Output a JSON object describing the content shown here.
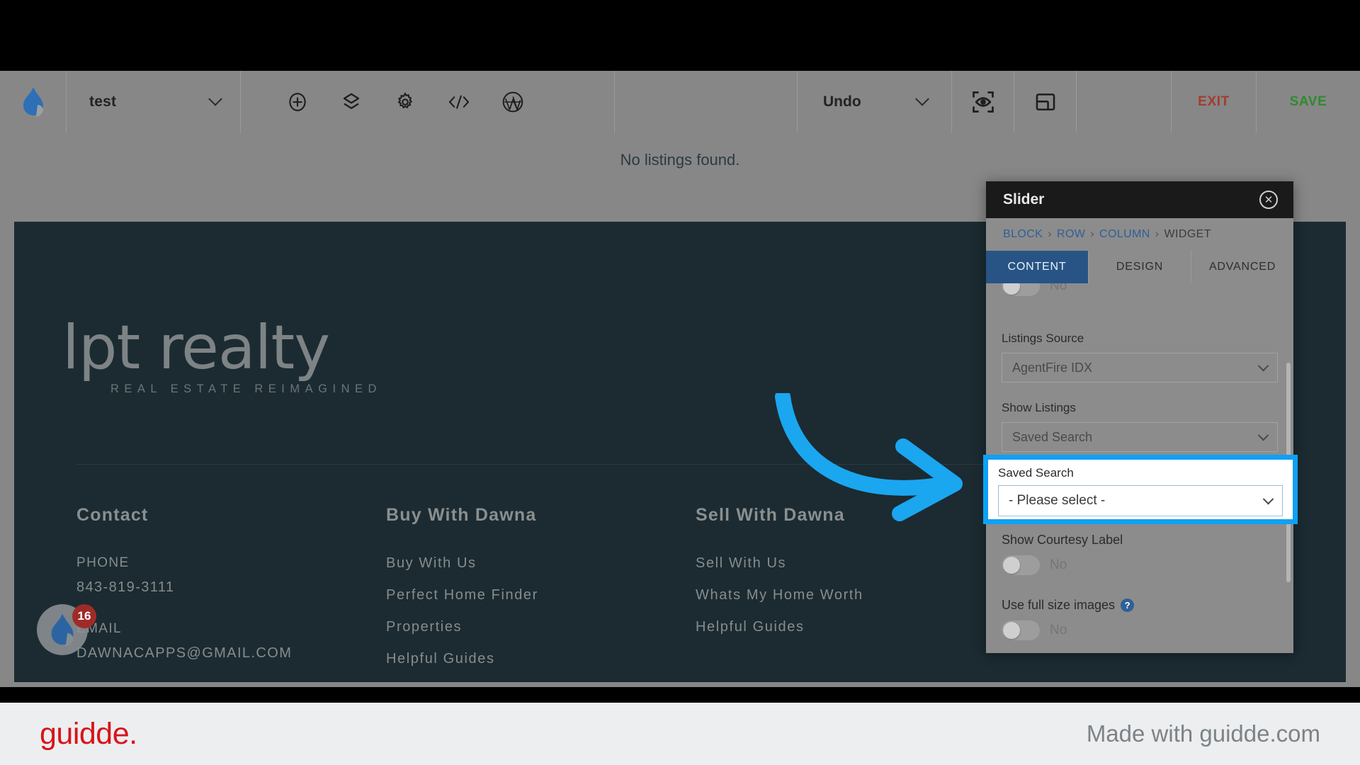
{
  "toolbar": {
    "site_title": "test",
    "icons": [
      "flame-logo-icon",
      "add-circle-icon",
      "layers-icon",
      "gear-icon",
      "code-icon",
      "wordpress-icon"
    ],
    "undo_label": "Undo",
    "preview_icon": "eye-frame-icon",
    "panel_icon": "panel-layout-icon",
    "exit_label": "EXIT",
    "save_label": "SAVE",
    "exit_color": "#a33c2e",
    "save_color": "#2f8a2f"
  },
  "canvas": {
    "no_listings": "No listings found.",
    "footer": {
      "logo_main": "lpt realty",
      "logo_sub": "REAL ESTATE REIMAGINED",
      "columns": [
        {
          "heading": "Contact",
          "sub_label_1": "PHONE",
          "sub_value_1": "843-819-3111",
          "sub_label_2": "EMAIL",
          "sub_value_2": "DAWNACAPPS@GMAIL.COM"
        },
        {
          "heading": "Buy With Dawna",
          "links": [
            "Buy With Us",
            "Perfect Home Finder",
            "Properties",
            "Helpful Guides"
          ]
        },
        {
          "heading": "Sell With Dawna",
          "links": [
            "Sell With Us",
            "Whats My Home Worth",
            "Helpful Guides"
          ]
        }
      ]
    },
    "chat_badge_count": "16"
  },
  "panel": {
    "title": "Slider",
    "close_icon": "close-icon",
    "breadcrumb": {
      "items": [
        "BLOCK",
        "ROW",
        "COLUMN",
        "WIDGET"
      ],
      "separator": "›"
    },
    "tabs": [
      {
        "label": "CONTENT",
        "active": true
      },
      {
        "label": "DESIGN",
        "active": false
      },
      {
        "label": "ADVANCED",
        "active": false
      }
    ],
    "cut_toggle_value": "No",
    "fields": [
      {
        "label": "Listings Source",
        "value": "AgentFire IDX"
      },
      {
        "label": "Show Listings",
        "value": "Saved Search"
      }
    ],
    "highlighted_field": {
      "label": "Saved Search",
      "value": "- Please select -",
      "highlight_color": "#0fa0f5"
    },
    "toggles": [
      {
        "label": "Show Courtesy Label",
        "value": "No",
        "help": false
      },
      {
        "label": "Use full size images",
        "value": "No",
        "help": true,
        "help_glyph": "?"
      }
    ]
  },
  "annotation": {
    "arrow_color": "#1ba6f0",
    "arrow_icon": "curved-arrow-icon"
  },
  "bottom_bar": {
    "logo_text": "guidde.",
    "made_with": "Made with guidde.com",
    "logo_color": "#d7141a"
  }
}
